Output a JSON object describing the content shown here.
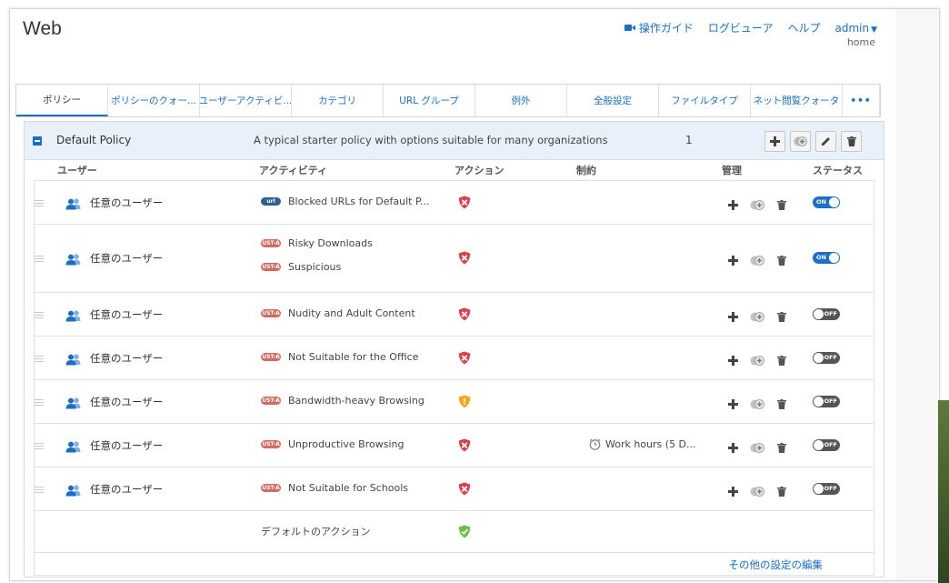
{
  "header": {
    "title": "Web",
    "nav": {
      "guide_label": "操作ガイド",
      "log_viewer_label": "ログビューア",
      "help_label": "ヘルプ",
      "admin_label": "admin",
      "admin_sub": "home"
    }
  },
  "tabs": [
    {
      "label": "ポリシー",
      "active": true
    },
    {
      "label": "ポリシーのクォー..."
    },
    {
      "label": "ユーザーアクティビ..."
    },
    {
      "label": "カテゴリ"
    },
    {
      "label": "URL グループ"
    },
    {
      "label": "例外"
    },
    {
      "label": "全般設定"
    },
    {
      "label": "ファイルタイプ"
    },
    {
      "label": "ネット閲覧クォータ"
    }
  ],
  "tabs_more_label": "•••",
  "policy": {
    "name": "Default Policy",
    "description": "A typical starter policy with options suitable for many organizations",
    "count": "1"
  },
  "columns": {
    "user": "ユーザー",
    "activity": "アクティビティ",
    "action": "アクション",
    "constraint": "制約",
    "manage": "管理",
    "status": "ステータス"
  },
  "rules": [
    {
      "user": "任意のユーザー",
      "activities": [
        {
          "badge": "url",
          "label": "Blocked URLs for Default P..."
        }
      ],
      "action": "block",
      "constraint": "",
      "status": "ON"
    },
    {
      "user": "任意のユーザー",
      "activities": [
        {
          "badge": "ust",
          "label": "Risky Downloads"
        },
        {
          "badge": "ust",
          "label": "Suspicious"
        }
      ],
      "action": "block",
      "constraint": "",
      "status": "ON"
    },
    {
      "user": "任意のユーザー",
      "activities": [
        {
          "badge": "ust",
          "label": "Nudity and Adult Content"
        }
      ],
      "action": "block",
      "constraint": "",
      "status": "OFF"
    },
    {
      "user": "任意のユーザー",
      "activities": [
        {
          "badge": "ust",
          "label": "Not Suitable for the Office"
        }
      ],
      "action": "block",
      "constraint": "",
      "status": "OFF"
    },
    {
      "user": "任意のユーザー",
      "activities": [
        {
          "badge": "ust",
          "label": "Bandwidth-heavy Browsing"
        }
      ],
      "action": "warn",
      "constraint": "",
      "status": "OFF"
    },
    {
      "user": "任意のユーザー",
      "activities": [
        {
          "badge": "ust",
          "label": "Unproductive Browsing"
        }
      ],
      "action": "block",
      "constraint": "Work hours (5 D...",
      "status": "OFF"
    },
    {
      "user": "任意のユーザー",
      "activities": [
        {
          "badge": "ust",
          "label": "Not Suitable for Schools"
        }
      ],
      "action": "block",
      "constraint": "",
      "status": "OFF"
    }
  ],
  "badge_text": {
    "url": "url",
    "ust": "UST-A"
  },
  "default_action": {
    "label": "デフォルトのアクション",
    "action": "allow"
  },
  "more_settings_label": "その他の設定の編集",
  "colors": {
    "accent": "#1a6fc4",
    "block": "#d9424a",
    "warn": "#f0a81c",
    "allow": "#6cbf3c",
    "toggle_on": "#1f6fc6",
    "toggle_off": "#555555"
  }
}
